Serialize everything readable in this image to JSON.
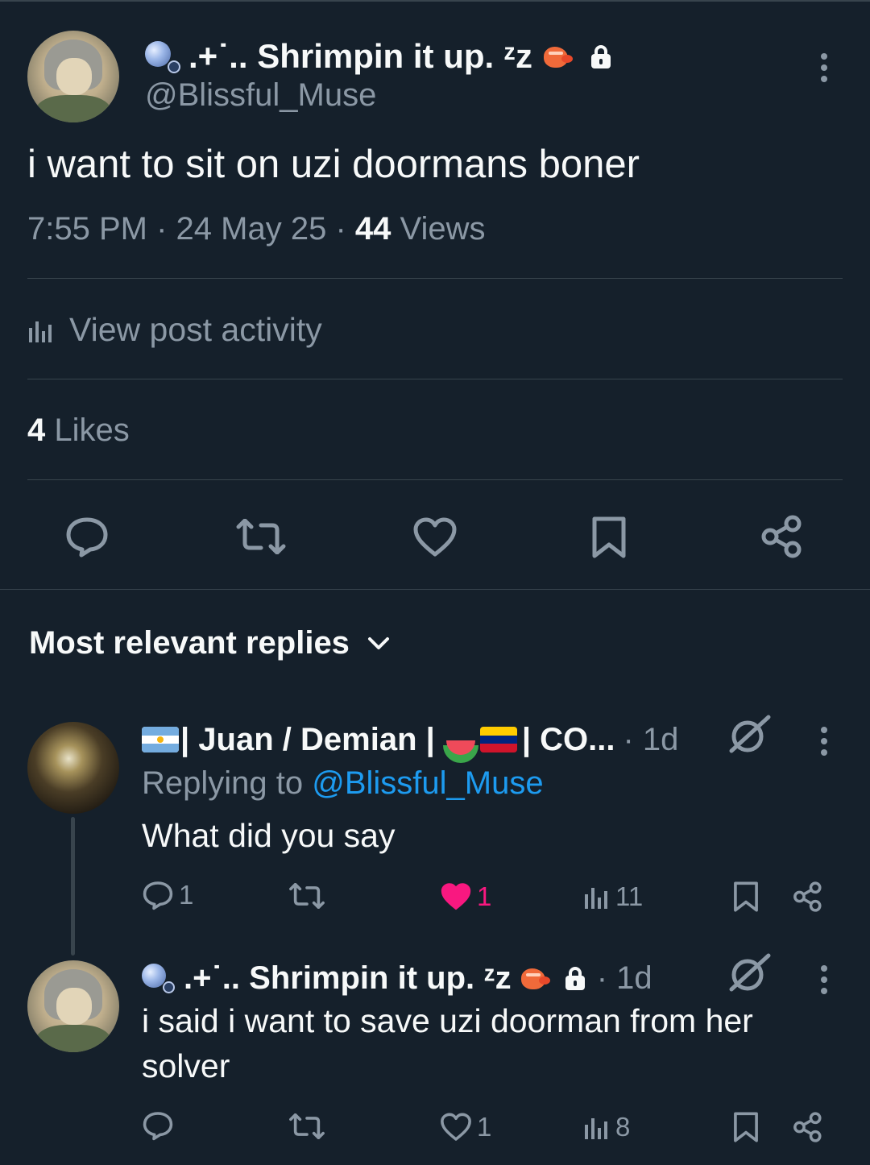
{
  "post": {
    "display_name": ".+˙.. Shrimpin it up. ᶻz",
    "handle": "@Blissful_Muse",
    "text": "i want to sit on uzi doormans boner",
    "time": "7:55 PM",
    "sep1": "·",
    "date": "24 May 25",
    "sep2": "·",
    "views_count": "44",
    "views_label": "Views",
    "activity_label": "View post activity",
    "likes_count": "4",
    "likes_label": "Likes"
  },
  "replies_header": {
    "label": "Most relevant replies"
  },
  "replies": [
    {
      "name_prefix": "| Juan / Demian |",
      "name_suffix": "| CO...",
      "time": "· 1d",
      "replying_to_label": "Replying to",
      "replying_to_handle": "@Blissful_Muse",
      "text": "What did you say",
      "reply_count": "1",
      "like_count": "1",
      "view_count": "11"
    },
    {
      "display_name": ".+˙.. Shrimpin it up. ᶻz",
      "time": "· 1d",
      "text_line1": "i said i want to save uzi doorman from her",
      "text_line2": "solver",
      "like_count": "1",
      "view_count": "8"
    }
  ],
  "colors": {
    "background": "#15202b",
    "text": "#f7f9f9",
    "muted": "#8b98a5",
    "link": "#1d9bf0",
    "like": "#f91880",
    "divider": "#38444d"
  },
  "icons": [
    "bubbles-icon",
    "shrimp-icon",
    "lock-icon",
    "more-icon",
    "reply-icon",
    "repost-icon",
    "like-icon",
    "bookmark-icon",
    "share-icon",
    "analytics-icon",
    "chevron-down-icon",
    "grok-icon",
    "argentina-flag-icon",
    "watermelon-icon",
    "venezuela-flag-icon"
  ]
}
